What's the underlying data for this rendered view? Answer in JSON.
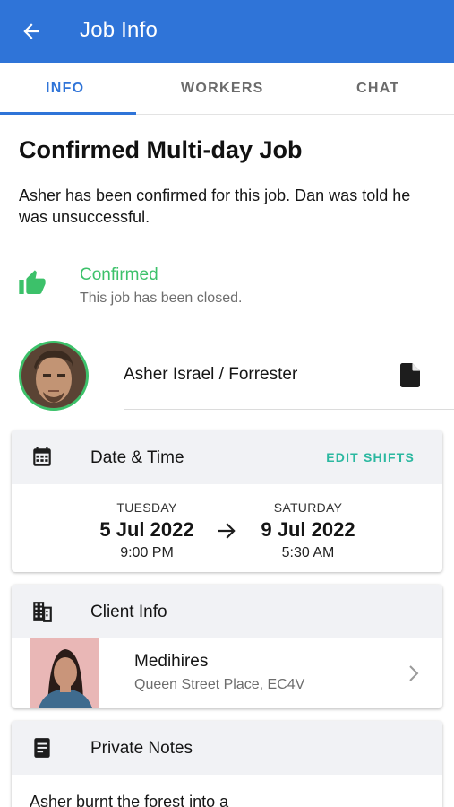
{
  "appbar": {
    "title": "Job Info"
  },
  "tabs": [
    {
      "label": "INFO",
      "active": true
    },
    {
      "label": "WORKERS",
      "active": false
    },
    {
      "label": "CHAT",
      "active": false
    }
  ],
  "job": {
    "title": "Confirmed Multi-day Job",
    "description": "Asher has been confirmed for this job. Dan was told he was unsuccessful."
  },
  "status": {
    "label": "Confirmed",
    "sublabel": "This job has been closed.",
    "icon": "thumbs-up-icon",
    "color": "#3cc16a"
  },
  "worker": {
    "name": "Asher Israel / Forrester",
    "icon": "document-icon"
  },
  "date_time": {
    "title": "Date & Time",
    "edit_label": "EDIT SHIFTS",
    "start": {
      "day": "TUESDAY",
      "date": "5 Jul 2022",
      "time": "9:00 PM"
    },
    "end": {
      "day": "SATURDAY",
      "date": "9 Jul 2022",
      "time": "5:30 AM"
    }
  },
  "client": {
    "title": "Client Info",
    "name": "Medihires",
    "address": "Queen Street Place, EC4V"
  },
  "notes": {
    "title": "Private Notes",
    "text": "Asher burnt the forest into a"
  },
  "colors": {
    "primary": "#2f74d8",
    "success": "#3cc16a",
    "accent": "#2bb8a0"
  }
}
